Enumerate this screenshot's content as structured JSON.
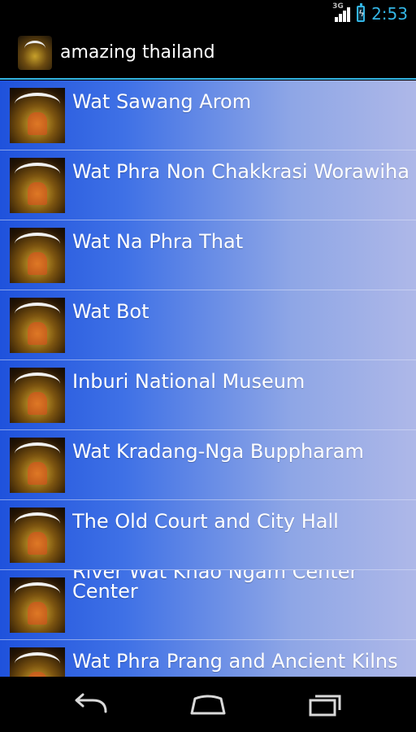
{
  "status_bar": {
    "network": "3G",
    "time": "2:53",
    "colors": {
      "accent": "#33b5e5"
    }
  },
  "action_bar": {
    "title": "amazing thailand",
    "icon": "app-logo-icon"
  },
  "list": {
    "items": [
      {
        "label": "Wat Sawang Arom"
      },
      {
        "label": "Wat Phra Non Chakkrasi Worawiha"
      },
      {
        "label": "Wat Na Phra That"
      },
      {
        "label": "Wat Bot"
      },
      {
        "label": "Inburi National Museum"
      },
      {
        "label": "Wat Kradang-Nga Buppharam"
      },
      {
        "label": "The Old Court and City Hall"
      },
      {
        "label": "Center",
        "clipped_line": "River Wat Khao Ngam Center"
      },
      {
        "label": "Wat Phra Prang and Ancient Kilns"
      }
    ],
    "thumbnail_icon": "temple-thumbnail-icon",
    "colors": {
      "gradient_start": "#1f52dc",
      "gradient_end": "#aeb8e8"
    }
  },
  "nav_bar": {
    "back": "back-icon",
    "home": "home-icon",
    "recents": "recent-apps-icon"
  }
}
